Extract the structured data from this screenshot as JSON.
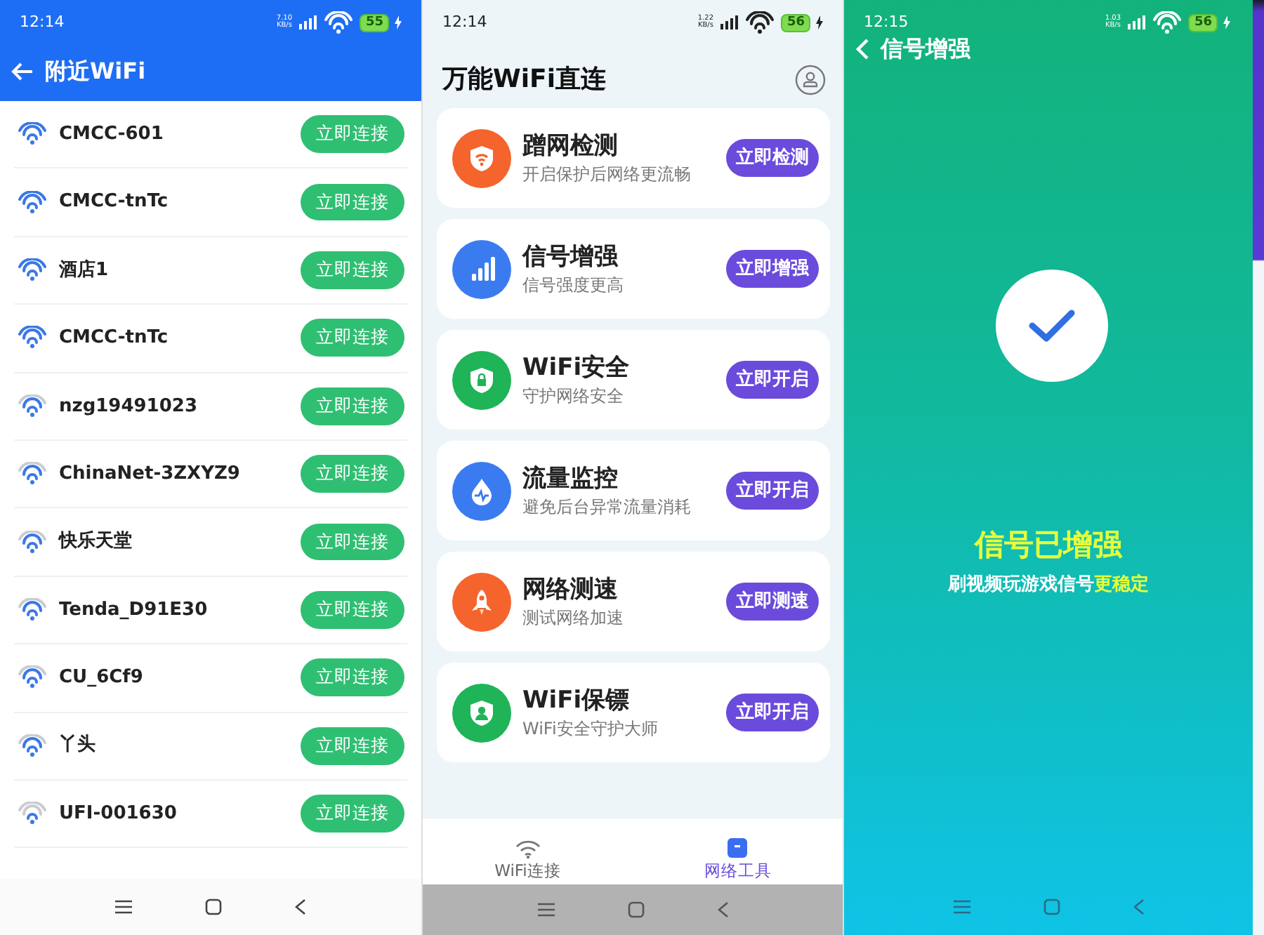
{
  "screens": [
    {
      "kind": "wifi_list",
      "status_bar": {
        "time": "12:14",
        "speed": "7.10",
        "speed_unit": "KB/s",
        "battery": "55"
      },
      "title": "附近WiFi",
      "networks": [
        {
          "name": "CMCC-601",
          "kind": "strong",
          "button": "立即连接"
        },
        {
          "name": "CMCC-tnTc",
          "kind": "strong",
          "button": "立即连接"
        },
        {
          "name": "酒店1",
          "kind": "strong",
          "button": "立即连接"
        },
        {
          "name": "CMCC-tnTc",
          "kind": "strong",
          "button": "立即连接"
        },
        {
          "name": "nzg19491023",
          "kind": "medium",
          "button": "立即连接"
        },
        {
          "name": "ChinaNet-3ZXYZ9",
          "kind": "medium",
          "button": "立即连接"
        },
        {
          "name": "快乐天堂",
          "kind": "medium",
          "button": "立即连接"
        },
        {
          "name": "Tenda_D91E30",
          "kind": "medium",
          "button": "立即连接"
        },
        {
          "name": "CU_6Cf9",
          "kind": "medium",
          "button": "立即连接"
        },
        {
          "name": "丫头",
          "kind": "medium",
          "button": "立即连接"
        },
        {
          "name": "UFI-001630",
          "kind": "weak",
          "button": "立即连接"
        }
      ]
    },
    {
      "kind": "tools",
      "status_bar": {
        "time": "12:14",
        "speed": "1.22",
        "speed_unit": "KB/s",
        "battery": "56"
      },
      "title": "万能WiFi直连",
      "tools": [
        {
          "color": "#f4642c",
          "title": "蹭网检测",
          "subtitle": "开启保护后网络更流畅",
          "button": "立即检测"
        },
        {
          "color": "#3a7cf0",
          "title": "信号增强",
          "subtitle": "信号强度更高",
          "button": "立即增强"
        },
        {
          "color": "#1fb457",
          "title": "WiFi安全",
          "subtitle": "守护网络安全",
          "button": "立即开启"
        },
        {
          "color": "#3a7cf0",
          "title": "流量监控",
          "subtitle": "避免后台异常流量消耗",
          "button": "立即开启"
        },
        {
          "color": "#f4642c",
          "title": "网络测速",
          "subtitle": "测试网络加速",
          "button": "立即测速"
        },
        {
          "color": "#1fb457",
          "title": "WiFi保镖",
          "subtitle": "WiFi安全守护大师",
          "button": "立即开启"
        }
      ],
      "tabs": [
        {
          "label": "WiFi连接",
          "selected": false
        },
        {
          "label": "网络工具",
          "selected": true
        }
      ]
    },
    {
      "kind": "result",
      "status_bar": {
        "time": "12:15",
        "speed": "1.03",
        "speed_unit": "KB/s",
        "battery": "56"
      },
      "title": "信号增强",
      "headline": "信号已增强",
      "subtitle": "刷视频玩游戏信号",
      "subtitle_highlight": "更稳定"
    }
  ]
}
